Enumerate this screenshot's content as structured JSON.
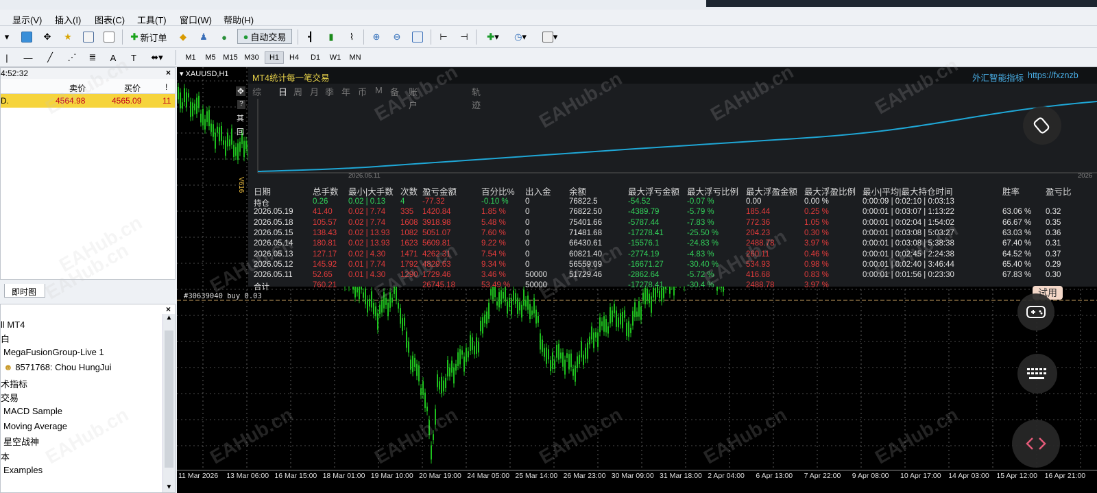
{
  "menu": [
    "显示(V)",
    "插入(I)",
    "图表(C)",
    "工具(T)",
    "窗口(W)",
    "帮助(H)"
  ],
  "toolbar": {
    "new_order": "新订单",
    "auto_trading": "自动交易"
  },
  "timeframes": [
    "M1",
    "M5",
    "M15",
    "M30",
    "H1",
    "H4",
    "D1",
    "W1",
    "MN"
  ],
  "active_timeframe": "H1",
  "market_watch": {
    "time": "4:52:32",
    "col_bid": "卖价",
    "col_ask": "买价",
    "col_excl": "!",
    "rows": [
      {
        "symbol": "D.",
        "bid": "4564.98",
        "ask": "4565.09",
        "spread": "11"
      }
    ],
    "tab": "即时图"
  },
  "navigator": {
    "items": [
      "ll MT4",
      "白",
      "MegaFusionGroup-Live 1",
      "8571768: Chou HungJui",
      "术指标",
      "交易",
      "MACD Sample",
      "Moving Average",
      "星空战神",
      "本",
      "Examples"
    ]
  },
  "chart": {
    "symbol": "XAUUSD,H1",
    "side_labels": [
      "?",
      "其",
      "回"
    ],
    "version": "V616",
    "order_line": "#30639040 buy 0.03",
    "x_labels": [
      "11 Mar 2026",
      "13 Mar 06:00",
      "16 Mar 15:00",
      "18 Mar 01:00",
      "19 Mar 10:00",
      "20 Mar 19:00",
      "24 Mar 05:00",
      "25 Mar 14:00",
      "26 Mar 23:00",
      "30 Mar 09:00",
      "31 Mar 18:00",
      "2 Apr 04:00",
      "6 Apr 13:00",
      "7 Apr 22:00",
      "9 Apr 08:00",
      "10 Apr 17:00",
      "14 Apr 03:00",
      "15 Apr 12:00",
      "16 Apr 21:00"
    ]
  },
  "stats": {
    "title": "MT4统计每一笔交易",
    "brand": "外汇智能指标",
    "url": "https://fxznzb",
    "tabs": [
      "综",
      "日",
      "周",
      "月",
      "季",
      "年",
      "币",
      "M",
      "备",
      "账户",
      "轨迹"
    ],
    "active_tab": "日",
    "equity_start_label": "2026.05.11",
    "equity_end_label": "2026",
    "headers": [
      "日期",
      "总手数",
      "最小|大手数",
      "次数",
      "盈亏金额",
      "百分比%",
      "出入金",
      "余额",
      "最大浮亏金额",
      "最大浮亏比例",
      "最大浮盈金额",
      "最大浮盈比例",
      "最小|平均|最大持仓时间",
      "胜率",
      "盈亏比"
    ],
    "rows": [
      [
        "持仓",
        "0.26",
        "0.02 | 0.13",
        "4",
        "-77.32",
        "-0.10 %",
        "0",
        "76822.5",
        "-54.52",
        "-0.07 %",
        "0.00",
        "0.00 %",
        "0:00:09 | 0:02:10 | 0:03:13",
        "",
        ""
      ],
      [
        "2026.05.19",
        "41.40",
        "0.02 | 7.74",
        "335",
        "1420.84",
        "1.85 %",
        "0",
        "76822.50",
        "-4389.79",
        "-5.79 %",
        "185.44",
        "0.25 %",
        "0:00:01 | 0:03:07 | 1:13:22",
        "63.06 %",
        "0.32"
      ],
      [
        "2026.05.18",
        "105.57",
        "0.02 | 7.74",
        "1608",
        "3918.98",
        "5.48 %",
        "0",
        "75401.66",
        "-5787.44",
        "-7.83 %",
        "772.36",
        "1.05 %",
        "0:00:01 | 0:02:04 | 1:54:02",
        "66.67 %",
        "0.35"
      ],
      [
        "2026.05.15",
        "138.43",
        "0.02 | 13.93",
        "1082",
        "5051.07",
        "7.60 %",
        "0",
        "71481.68",
        "-17278.41",
        "-25.50 %",
        "204.23",
        "0.30 %",
        "0:00:01 | 0:03:08 | 5:03:27",
        "63.03 %",
        "0.36"
      ],
      [
        "2026.05.14",
        "180.81",
        "0.02 | 13.93",
        "1623",
        "5609.81",
        "9.22 %",
        "0",
        "66430.61",
        "-15576.1",
        "-24.83 %",
        "2488.78",
        "3.97 %",
        "0:00:01 | 0:03:08 | 5:38:38",
        "67.40 %",
        "0.31"
      ],
      [
        "2026.05.13",
        "127.17",
        "0.02 | 4.30",
        "1471",
        "4262.31",
        "7.54 %",
        "0",
        "60821.40",
        "-2774.19",
        "-4.83 %",
        "260.11",
        "0.46 %",
        "0:00:01 | 0:02:45 | 2:24:38",
        "64.52 %",
        "0.37"
      ],
      [
        "2026.05.12",
        "145.92",
        "0.01 | 7.74",
        "1792",
        "4829.63",
        "9.34 %",
        "0",
        "56559.09",
        "-16671.27",
        "-30.40 %",
        "534.93",
        "0.98 %",
        "0:00:01 | 0:02:40 | 3:46:44",
        "65.40 %",
        "0.29"
      ],
      [
        "2026.05.11",
        "52.65",
        "0.01 | 4.30",
        "1290",
        "1729.46",
        "3.46 %",
        "50000",
        "51729.46",
        "-2862.64",
        "-5.72 %",
        "416.68",
        "0.83 %",
        "0:00:01 | 0:01:56 | 0:23:30",
        "67.83 %",
        "0.30"
      ],
      [
        "合计",
        "760.21",
        "",
        "",
        "26745.18",
        "53.49 %",
        "50000",
        "",
        "-17278.41",
        "-30.4 %",
        "2488.78",
        "3.97 %",
        "",
        "",
        ""
      ]
    ]
  },
  "floating": {
    "trial_label": "试用"
  },
  "watermark": "EAHub.cn",
  "colors": {
    "up_green": "#32d15a",
    "down_red": "#e23b3b",
    "equity_line": "#1fa7d6",
    "market_row": "#f6d43c",
    "candles": "#1ec21e"
  }
}
